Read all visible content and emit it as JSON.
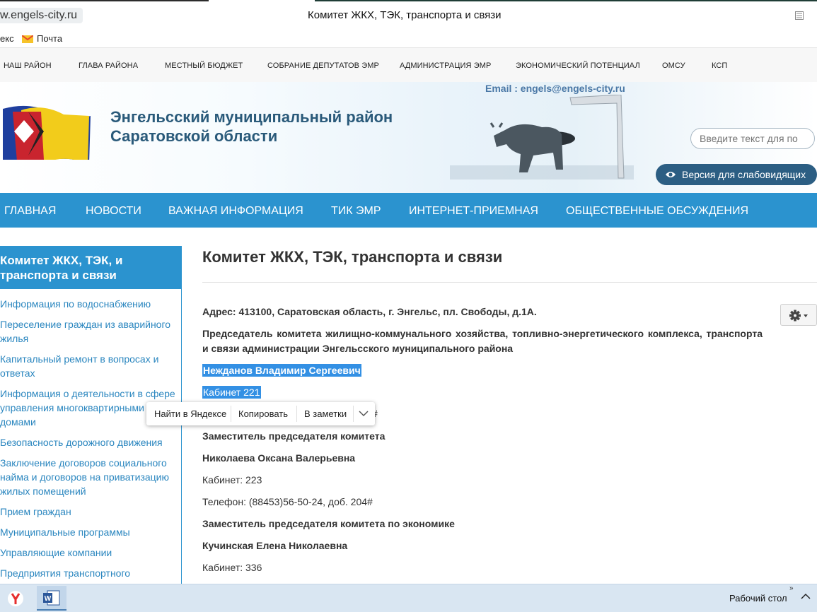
{
  "browser": {
    "url": "w.engels-city.ru",
    "tab_title": "Комитет ЖКХ, ТЭК, транспорта и связи",
    "bookmarks": [
      "екс",
      "Почта"
    ]
  },
  "top_menu": [
    "НАШ РАЙОН",
    "ГЛАВА РАЙОНА",
    "МЕСТНЫЙ БЮДЖЕТ",
    "СОБРАНИЕ ДЕПУТАТОВ ЭМР",
    "АДМИНИСТРАЦИЯ ЭМР",
    "ЭКОНОМИЧЕСКИЙ ПОТЕНЦИАЛ",
    "ОМСУ",
    "КСП"
  ],
  "header": {
    "title_line1": "Энгельсский муниципальный район",
    "title_line2": "Саратовской области",
    "email": "Email : engels@engels-city.ru",
    "search_placeholder": "Введите текст для по",
    "a11y_label": "Версия для слабовидящих"
  },
  "main_nav": [
    "ГЛАВНАЯ",
    "НОВОСТИ",
    "ВАЖНАЯ ИНФОРМАЦИЯ",
    "ТИК ЭМР",
    "ИНТЕРНЕТ-ПРИЕМНАЯ",
    "ОБЩЕСТВЕННЫЕ ОБСУЖДЕНИЯ"
  ],
  "sidebar": {
    "heading_line1": "Комитет ЖКХ, ТЭК, и",
    "heading_line2": "транспорта и связи",
    "items": [
      "Информация по водоснабжению",
      "Переселение граждан из аварийного жилья",
      "Капитальный ремонт в вопросах и ответах",
      "Информация о деятельности в сфере управления многоквартирными домами",
      "Безопасность дорожного движения",
      "Заключение договоров социального найма и договоров на приватизацию жилых помещений",
      "Прием граждан",
      "Муниципальные программы",
      "Управляющие компании",
      "Предприятия транспортного"
    ]
  },
  "content": {
    "title": "Комитет ЖКХ, ТЭК, транспорта и связи",
    "address": "Адрес: 413100, Саратовская область, г. Энгельс, пл. Свободы, д.1А.",
    "chairman_desc": "Председатель комитета жилищно-коммунального хозяйства, топливно-энергетического комплекса, транспорта и связи администрации Энгельсского муниципального района",
    "chairman_name": "Нежданов Владимир Сергеевич",
    "chairman_cabinet": "Кабинет 221",
    "phone_tail": "#",
    "deputy1_title": "Заместитель председателя комитета",
    "deputy1_name": "Николаева Оксана Валерьевна",
    "deputy1_cabinet": "Кабинет: 223",
    "deputy1_phone": "Телефон: (88453)56-50-24, доб. 204#",
    "deputy2_title": "Заместитель председателя комитета по экономике",
    "deputy2_name": "Кучинская Елена Николаевна",
    "deputy2_cabinet": "Кабинет: 336"
  },
  "popup": {
    "find": "Найти в Яндексе",
    "copy": "Копировать",
    "notes": "В заметки"
  },
  "taskbar": {
    "desktop": "Рабочий стол",
    "chevrons": "»"
  },
  "colors": {
    "nav_blue": "#2b93cf",
    "a11y_button": "#2c5e83",
    "link": "#2a86bf",
    "selection": "#3390e4"
  }
}
